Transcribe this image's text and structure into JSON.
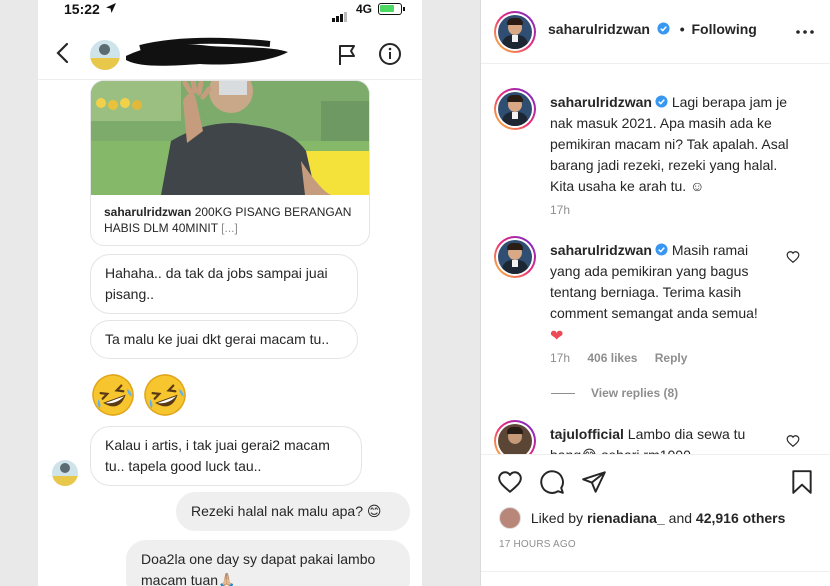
{
  "phone": {
    "status": {
      "time": "15:22",
      "network": "4G"
    },
    "shared_post": {
      "username": "saharulridzwan",
      "caption": "200KG PISANG BERANGAN HABIS DLM 40MINIT",
      "more": "[...]"
    },
    "messages": [
      {
        "text": "Hahaha.. da tak da jobs sampai juai pisang..",
        "from": "them"
      },
      {
        "text": "Ta malu ke juai dkt gerai macam tu..",
        "from": "them"
      },
      {
        "text": "Kalau i artis, i tak juai gerai2 macam tu.. tapela good luck tau..",
        "from": "them"
      },
      {
        "text": "Rezeki halal nak malu apa? 😊",
        "from": "me"
      },
      {
        "text": "Doa2la one day sy dapat pakai lambo macam tuan🙏🏼",
        "from": "me"
      }
    ]
  },
  "post": {
    "author": "saharulridzwan",
    "separator": "•",
    "follow_status": "Following",
    "comments": [
      {
        "username": "saharulridzwan",
        "text": "Lagi berapa jam je nak masuk 2021. Apa masih ada ke pemikiran macam ni? Tak apalah. Asal barang jadi rezeki, rezeki yang halal. Kita usaha ke arah tu. ☺",
        "time": "17h"
      },
      {
        "username": "saharulridzwan",
        "text": "Masih ramai yang ada pemikiran yang bagus tentang berniaga. Terima kasih comment semangat anda semua!",
        "emoji": "❤",
        "time": "17h",
        "likes": "406 likes",
        "reply": "Reply",
        "view_replies": "View replies (8)"
      },
      {
        "username": "tajulofficial",
        "text": "Lambo dia sewa tu bang😂 sehari rm1000"
      }
    ],
    "liked_by": {
      "prefix": "Liked by",
      "user": "rienadiana_",
      "and": "and",
      "others": "42,916 others"
    },
    "timestamp": "17 HOURS AGO"
  },
  "colors": {
    "verified": "#3897f0",
    "heart": "#ed4956",
    "muted": "#8e8e8e",
    "story_ring": "#ee2a7b"
  },
  "icons": [
    "location-arrow-icon",
    "signal-icon",
    "battery-icon",
    "back-chevron-icon",
    "flag-icon",
    "info-icon",
    "verified-badge-icon",
    "more-icon",
    "heart-icon",
    "comment-icon",
    "share-icon",
    "bookmark-icon",
    "rofl-emoji-icon"
  ]
}
